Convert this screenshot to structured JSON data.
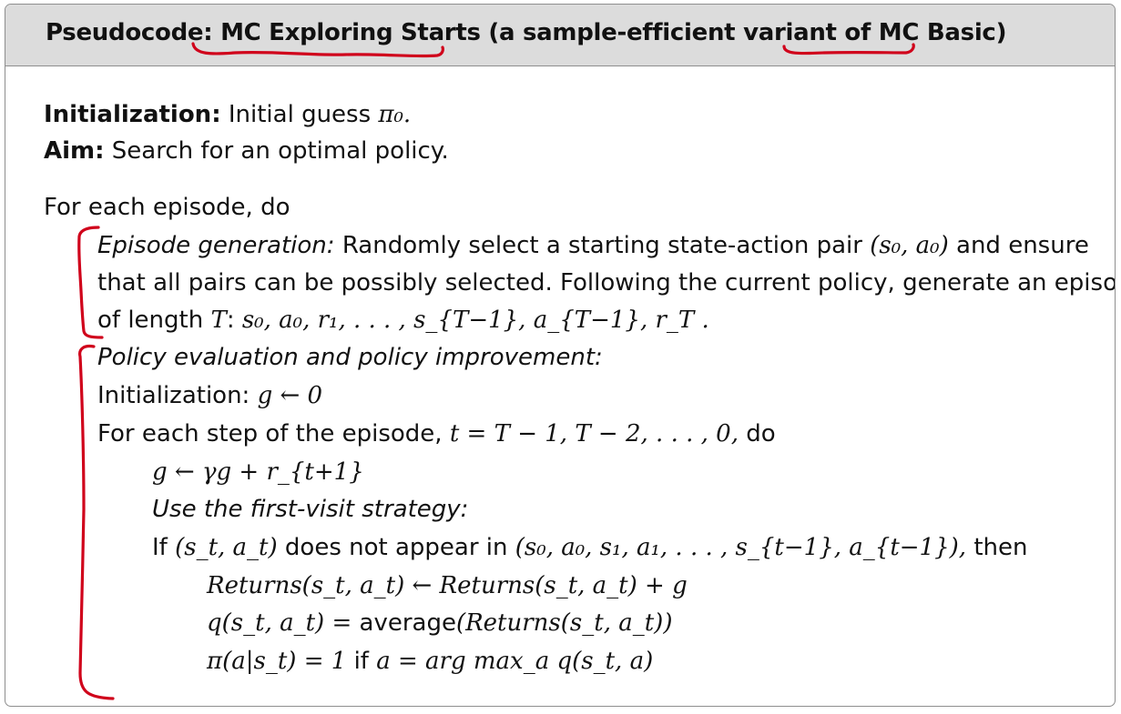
{
  "header": {
    "prefix": "Pseudocode:",
    "algorithm_name": "MC Exploring Starts",
    "paren_open": "(a sample-efficient variant of",
    "base_name": "MC Basic",
    "paren_close": ")"
  },
  "init": {
    "label": "Initialization:",
    "text": "Initial guess",
    "math": "π₀."
  },
  "aim": {
    "label": "Aim:",
    "text": "Search for an optimal policy."
  },
  "loop": {
    "text": "For each episode, do"
  },
  "episode_generation": {
    "label": "Episode generation:",
    "line1": "Randomly select a starting state-action pair",
    "line1_math": "(s₀, a₀)",
    "line1_end": "and ensure",
    "line2": "that all pairs can be possibly selected. Following the current policy, generate an episode",
    "line3_text": "of length",
    "line3_T": "T",
    "line3_colon": ":",
    "line3_math": "s₀, a₀, r₁, . . . , s_{T−1}, a_{T−1}, r_T ."
  },
  "policy_eval": {
    "label": "Policy evaluation and policy improvement:",
    "init_text": "Initialization:",
    "init_math": "g ← 0",
    "step_text": "For each step of the episode,",
    "step_math": "t = T − 1, T − 2, . . . , 0,",
    "step_end": "do",
    "g_update": "g ← γg + r_{t+1}",
    "strategy": "Use the first-visit strategy:",
    "if_text": "If",
    "if_math1": "(s_t, a_t)",
    "if_mid": "does not appear in",
    "if_math2": "(s₀, a₀, s₁, a₁, . . . , s_{t−1}, a_{t−1}),",
    "if_end": "then",
    "returns_update": "Returns(s_t, a_t) ← Returns(s_t, a_t) + g",
    "q_left": "q(s_t, a_t) =",
    "q_avg": "average",
    "q_right": "(Returns(s_t, a_t))",
    "pi_left": "π(a|s_t) = 1",
    "pi_if": "if",
    "pi_right": "a = arg max_a q(s_t, a)"
  },
  "annotation_color": "#d0021b"
}
